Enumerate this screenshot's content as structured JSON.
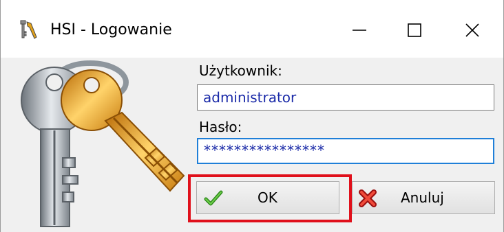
{
  "window": {
    "title": "HSI - Logowanie",
    "title_icon": "keys-icon",
    "controls": {
      "minimize_icon": "minimize-icon",
      "maximize_icon": "maximize-icon",
      "close_icon": "close-icon"
    }
  },
  "form": {
    "username_label": "Użytkownik:",
    "username_value": "administrator",
    "password_label": "Hasło:",
    "password_value": "****************"
  },
  "buttons": {
    "ok_label": "OK",
    "ok_icon": "checkmark-icon",
    "cancel_label": "Anuluj",
    "cancel_icon": "red-x-icon"
  },
  "colors": {
    "highlight": "#e0101b",
    "focus_border": "#1f7fd8",
    "input_text": "#1a2aa8",
    "window_bg": "#f0f0f0"
  }
}
